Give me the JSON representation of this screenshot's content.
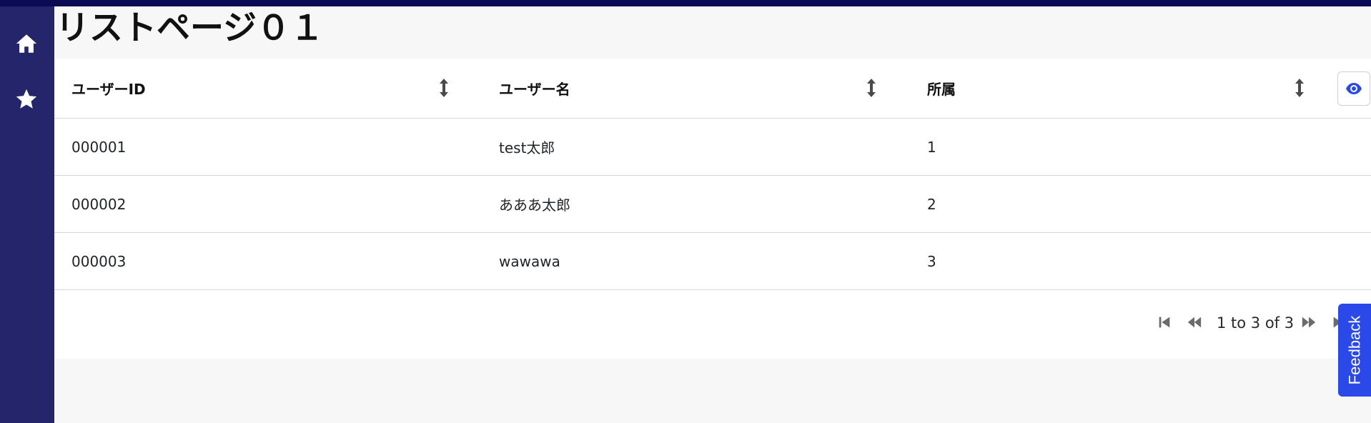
{
  "page": {
    "title": "リストページ０１"
  },
  "sidebar": {
    "items": [
      {
        "name": "Home",
        "icon": "home-icon"
      },
      {
        "name": "Favorites",
        "icon": "star-icon"
      }
    ]
  },
  "table": {
    "columns": [
      {
        "label": "ユーザーID"
      },
      {
        "label": "ユーザー名"
      },
      {
        "label": "所属"
      }
    ],
    "rows": [
      [
        "000001",
        "test太郎",
        "1"
      ],
      [
        "000002",
        "あああ太郎",
        "2"
      ],
      [
        "000003",
        "wawawa",
        "3"
      ]
    ]
  },
  "pagination": {
    "summary": "1 to 3 of 3"
  },
  "feedback": {
    "label": "Feedback"
  },
  "colors": {
    "sidebar": "#25256b",
    "topbar": "#0a0a55",
    "accent": "#2a49e8"
  }
}
